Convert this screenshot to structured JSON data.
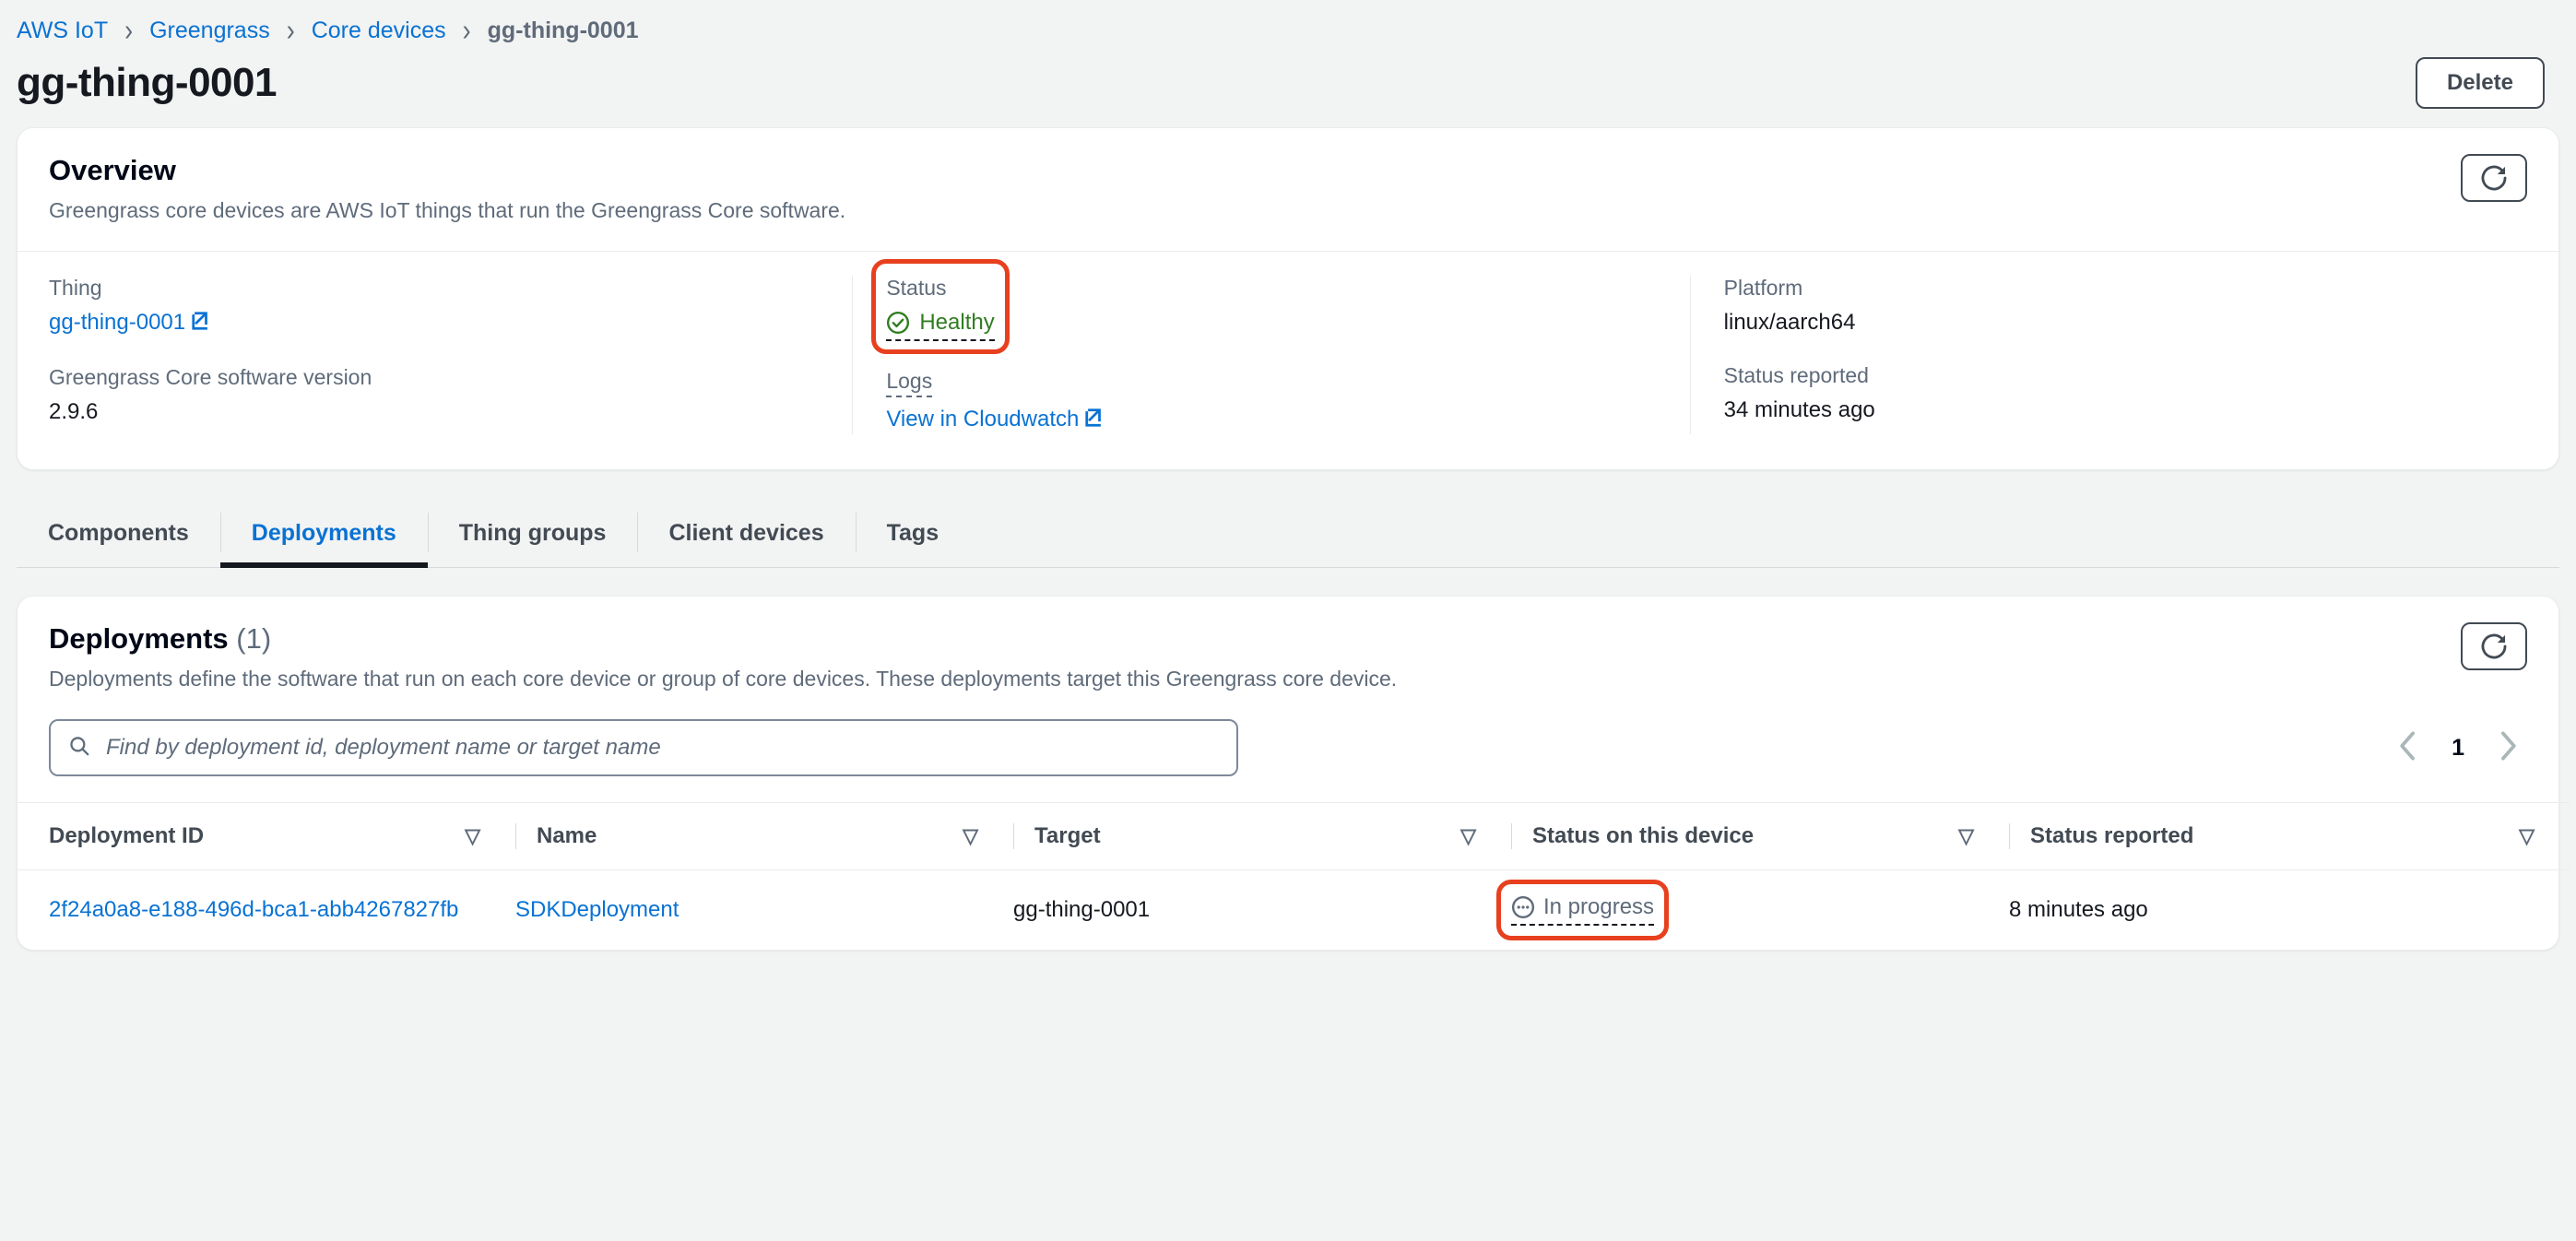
{
  "breadcrumb": {
    "items": [
      {
        "label": "AWS IoT",
        "current": false
      },
      {
        "label": "Greengrass",
        "current": false
      },
      {
        "label": "Core devices",
        "current": false
      },
      {
        "label": "gg-thing-0001",
        "current": true
      }
    ],
    "separator": "›"
  },
  "header": {
    "title": "gg-thing-0001",
    "delete_label": "Delete"
  },
  "overview": {
    "title": "Overview",
    "description": "Greengrass core devices are AWS IoT things that run the Greengrass Core software.",
    "refresh_icon": "refresh-icon",
    "thing": {
      "label": "Thing",
      "value": "gg-thing-0001",
      "external_icon": "external-link-icon"
    },
    "version": {
      "label": "Greengrass Core software version",
      "value": "2.9.6"
    },
    "status": {
      "label": "Status",
      "value": "Healthy",
      "icon": "status-positive-icon",
      "color": "#2f7d20",
      "highlighted": true,
      "highlight_color": "#e8401f"
    },
    "logs": {
      "label": "Logs",
      "value": "View in Cloudwatch",
      "external_icon": "external-link-icon"
    },
    "platform": {
      "label": "Platform",
      "value": "linux/aarch64"
    },
    "status_reported": {
      "label": "Status reported",
      "value": "34 minutes ago"
    }
  },
  "tabs": [
    {
      "label": "Components",
      "active": false
    },
    {
      "label": "Deployments",
      "active": true
    },
    {
      "label": "Thing groups",
      "active": false
    },
    {
      "label": "Client devices",
      "active": false
    },
    {
      "label": "Tags",
      "active": false
    }
  ],
  "deployments": {
    "title": "Deployments",
    "count": "(1)",
    "description": "Deployments define the software that run on each core device or group of core devices. These deployments target this Greengrass core device.",
    "refresh_icon": "refresh-icon",
    "search": {
      "placeholder": "Find by deployment id, deployment name or target name",
      "value": "",
      "icon": "search-icon"
    },
    "pagination": {
      "prev_icon": "chevron-left-icon",
      "page": "1",
      "next_icon": "chevron-right-icon"
    },
    "columns": [
      {
        "label": "Deployment ID",
        "sort_icon": "sort-triangle-icon"
      },
      {
        "label": "Name",
        "sort_icon": "sort-triangle-icon"
      },
      {
        "label": "Target",
        "sort_icon": "sort-triangle-icon"
      },
      {
        "label": "Status on this device",
        "sort_icon": "sort-triangle-icon"
      },
      {
        "label": "Status reported",
        "sort_icon": "sort-triangle-icon"
      }
    ],
    "rows": [
      {
        "deployment_id": "2f24a0a8-e188-496d-bca1-abb4267827fb",
        "name": "SDKDeployment",
        "target": "gg-thing-0001",
        "status_on_device": "In progress",
        "status_icon": "status-in-progress-icon",
        "status_highlighted": true,
        "status_reported": "8 minutes ago"
      }
    ]
  },
  "colors": {
    "link": "#0972d3",
    "positive": "#2f7d20",
    "annotation": "#e8401f",
    "text": "#16191f",
    "muted": "#5f6b7a"
  }
}
